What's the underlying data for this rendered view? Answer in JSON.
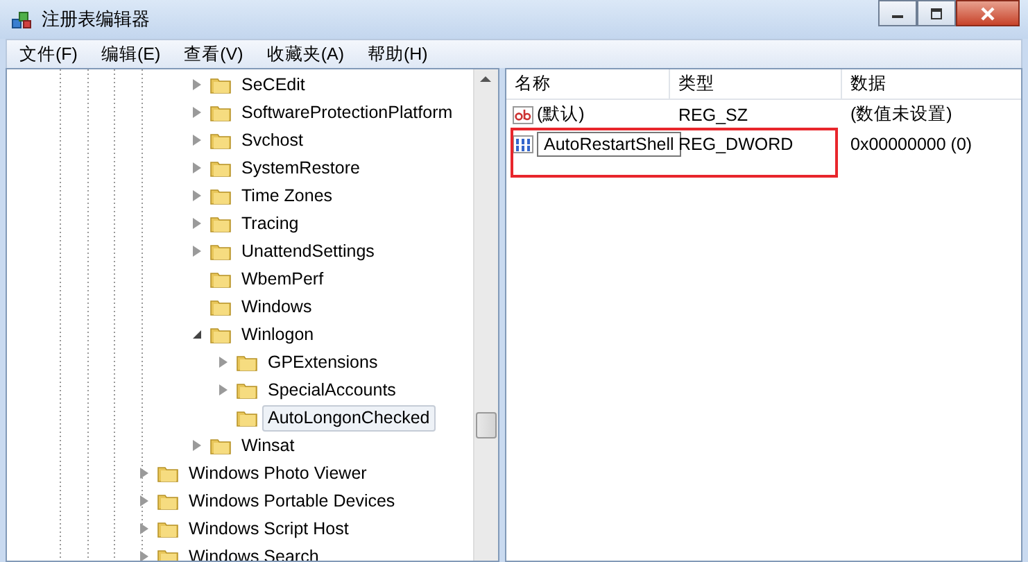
{
  "window": {
    "title": "注册表编辑器"
  },
  "menu": [
    {
      "label": "文件(F)"
    },
    {
      "label": "编辑(E)"
    },
    {
      "label": "查看(V)"
    },
    {
      "label": "收藏夹(A)"
    },
    {
      "label": "帮助(H)"
    }
  ],
  "tree": {
    "nested_items": [
      {
        "label": "SeCEdit",
        "expanded": false,
        "selected": false
      },
      {
        "label": "SoftwareProtectionPlatform",
        "expanded": false,
        "selected": false
      },
      {
        "label": "Svchost",
        "expanded": false,
        "selected": false
      },
      {
        "label": "SystemRestore",
        "expanded": false,
        "selected": false
      },
      {
        "label": "Time Zones",
        "expanded": false,
        "selected": false
      },
      {
        "label": "Tracing",
        "expanded": false,
        "selected": false
      },
      {
        "label": "UnattendSettings",
        "expanded": false,
        "selected": false
      },
      {
        "label": "WbemPerf",
        "selected": false
      },
      {
        "label": "Windows",
        "selected": false
      },
      {
        "label": "Winlogon",
        "expanded": true,
        "selected": false,
        "children": [
          {
            "label": "GPExtensions",
            "expanded": false,
            "selected": false
          },
          {
            "label": "SpecialAccounts",
            "expanded": false,
            "selected": false
          },
          {
            "label": "AutoLongonChecked",
            "selected": true
          }
        ]
      },
      {
        "label": "Winsat",
        "expanded": false,
        "selected": false
      }
    ],
    "items": [
      {
        "label": "Windows Photo Viewer",
        "expanded": false,
        "selected": false
      },
      {
        "label": "Windows Portable Devices",
        "expanded": false,
        "selected": false
      },
      {
        "label": "Windows Script Host",
        "expanded": false,
        "selected": false
      },
      {
        "label": "Windows Search",
        "expanded": false,
        "selected": false
      }
    ]
  },
  "values": {
    "columns": [
      "名称",
      "类型",
      "数据"
    ],
    "rows": [
      {
        "kind": "string",
        "name": "(默认)",
        "type": "REG_SZ",
        "data": "(数值未设置)",
        "editing": false
      },
      {
        "kind": "dword",
        "name": "AutoRestartShell",
        "type": "REG_DWORD",
        "data": "0x00000000 (0)",
        "editing": true
      }
    ],
    "highlight_frame": true
  }
}
